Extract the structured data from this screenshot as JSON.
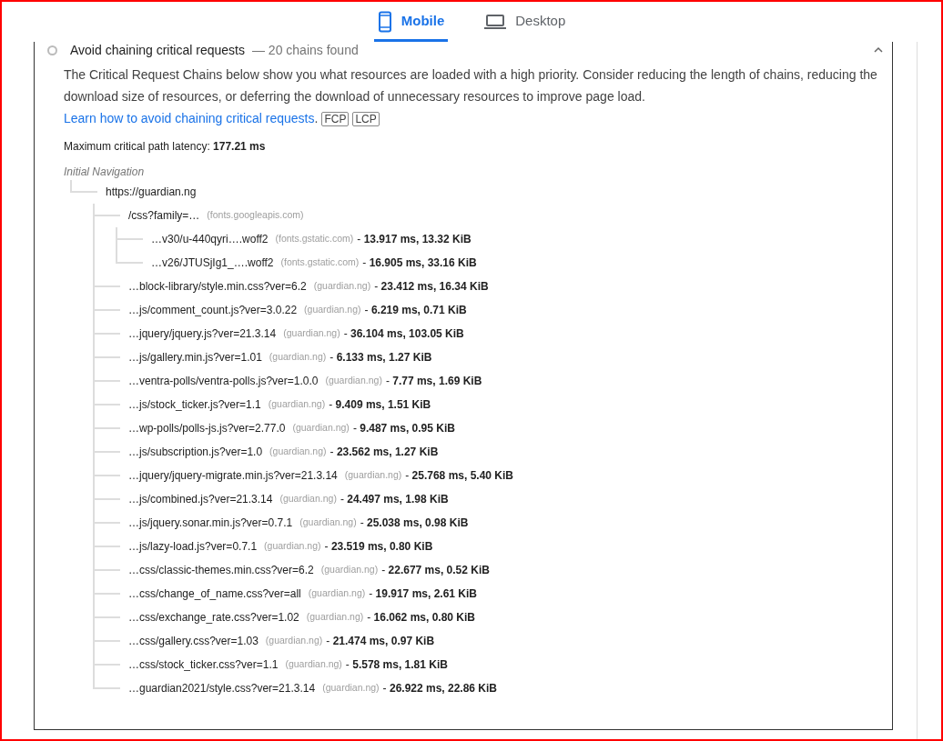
{
  "tabs": [
    {
      "label": "Mobile",
      "kind": "phone",
      "selected": true
    },
    {
      "label": "Desktop",
      "kind": "laptop",
      "selected": false
    }
  ],
  "audit": {
    "title": "Avoid chaining critical requests",
    "display_value": "— 20 chains found",
    "expanded": true,
    "description": "The Critical Request Chains below show you what resources are loaded with a high priority. Consider reducing the length of chains, reducing the download size of resources, or deferring the download of unnecessary resources to improve page load.",
    "link": "Learn how to avoid chaining critical requests",
    "link_suffix": ".",
    "badges": [
      "FCP",
      "LCP"
    ],
    "latency": "Maximum critical path latency: **177.21 ms**",
    "tree": {
      "label": "Initial Navigation",
      "children": [
        {
          "url": "https://guardian.ng",
          "children": [
            {
              "url": "/css?family=…",
              "host": "(fonts.googleapis.com)",
              "children": [
                {
                  "url": "…v30/u-440qyri….woff2",
                  "host": "(fonts.gstatic.com)",
                  "timing": "- **13.917 ms, 13.32 KiB**"
                },
                {
                  "url": "…v26/JTUSjIg1_….woff2",
                  "host": "(fonts.gstatic.com)",
                  "timing": "- **16.905 ms, 33.16 KiB**"
                }
              ]
            },
            {
              "url": "…block-library/style.min.css?ver=6.2",
              "host": "(guardian.ng)",
              "timing": "- **23.412 ms, 16.34 KiB**"
            },
            {
              "url": "…js/comment_count.js?ver=3.0.22",
              "host": "(guardian.ng)",
              "timing": "- **6.219 ms, 0.71 KiB**"
            },
            {
              "url": "…jquery/jquery.js?ver=21.3.14",
              "host": "(guardian.ng)",
              "timing": "- **36.104 ms, 103.05 KiB**"
            },
            {
              "url": "…js/gallery.min.js?ver=1.01",
              "host": "(guardian.ng)",
              "timing": "- **6.133 ms, 1.27 KiB**"
            },
            {
              "url": "…ventra-polls/ventra-polls.js?ver=1.0.0",
              "host": "(guardian.ng)",
              "timing": "- **7.77 ms, 1.69 KiB**"
            },
            {
              "url": "…js/stock_ticker.js?ver=1.1",
              "host": "(guardian.ng)",
              "timing": "- **9.409 ms, 1.51 KiB**"
            },
            {
              "url": "…wp-polls/polls-js.js?ver=2.77.0",
              "host": "(guardian.ng)",
              "timing": "- **9.487 ms, 0.95 KiB**"
            },
            {
              "url": "…js/subscription.js?ver=1.0",
              "host": "(guardian.ng)",
              "timing": "- **23.562 ms, 1.27 KiB**"
            },
            {
              "url": "…jquery/jquery-migrate.min.js?ver=21.3.14",
              "host": "(guardian.ng)",
              "timing": "- **25.768 ms, 5.40 KiB**"
            },
            {
              "url": "…js/combined.js?ver=21.3.14",
              "host": "(guardian.ng)",
              "timing": "- **24.497 ms, 1.98 KiB**"
            },
            {
              "url": "…js/jquery.sonar.min.js?ver=0.7.1",
              "host": "(guardian.ng)",
              "timing": "- **25.038 ms, 0.98 KiB**"
            },
            {
              "url": "…js/lazy-load.js?ver=0.7.1",
              "host": "(guardian.ng)",
              "timing": "- **23.519 ms, 0.80 KiB**"
            },
            {
              "url": "…css/classic-themes.min.css?ver=6.2",
              "host": "(guardian.ng)",
              "timing": "- **22.677 ms, 0.52 KiB**"
            },
            {
              "url": "…css/change_of_name.css?ver=all",
              "host": "(guardian.ng)",
              "timing": "- **19.917 ms, 2.61 KiB**"
            },
            {
              "url": "…css/exchange_rate.css?ver=1.02",
              "host": "(guardian.ng)",
              "timing": "- **16.062 ms, 0.80 KiB**"
            },
            {
              "url": "…css/gallery.css?ver=1.03",
              "host": "(guardian.ng)",
              "timing": "- **21.474 ms, 0.97 KiB**"
            },
            {
              "url": "…css/stock_ticker.css?ver=1.1",
              "host": "(guardian.ng)",
              "timing": "- **5.578 ms, 1.81 KiB**"
            },
            {
              "url": "…guardian2021/style.css?ver=21.3.14",
              "host": "(guardian.ng)",
              "timing": "- **26.922 ms, 22.86 KiB**"
            }
          ]
        }
      ]
    }
  }
}
